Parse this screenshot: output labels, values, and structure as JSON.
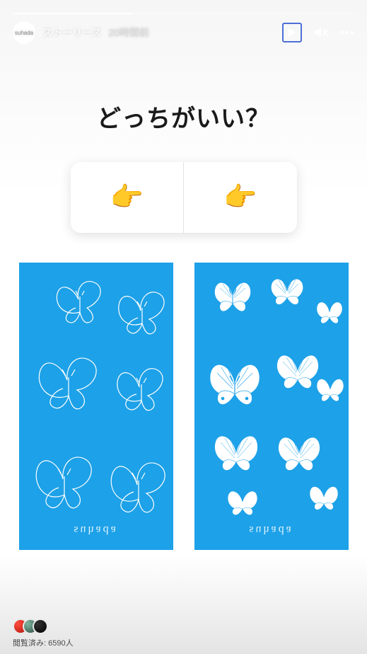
{
  "header": {
    "author_avatar_text": "suhada",
    "username": "ストーリーズ",
    "timestamp": "20時間前"
  },
  "content": {
    "question": "どっちがいい？",
    "poll": {
      "left_emoji": "👉",
      "right_emoji": "👉"
    },
    "designs": {
      "left_brand": "suhada",
      "right_brand": "suhada",
      "card_color": "#1da1e8"
    }
  },
  "footer": {
    "views_label": "閲覧済み: 6590人"
  },
  "icons": {
    "play": "play-icon",
    "mute": "mute-icon",
    "more": "more-icon"
  }
}
